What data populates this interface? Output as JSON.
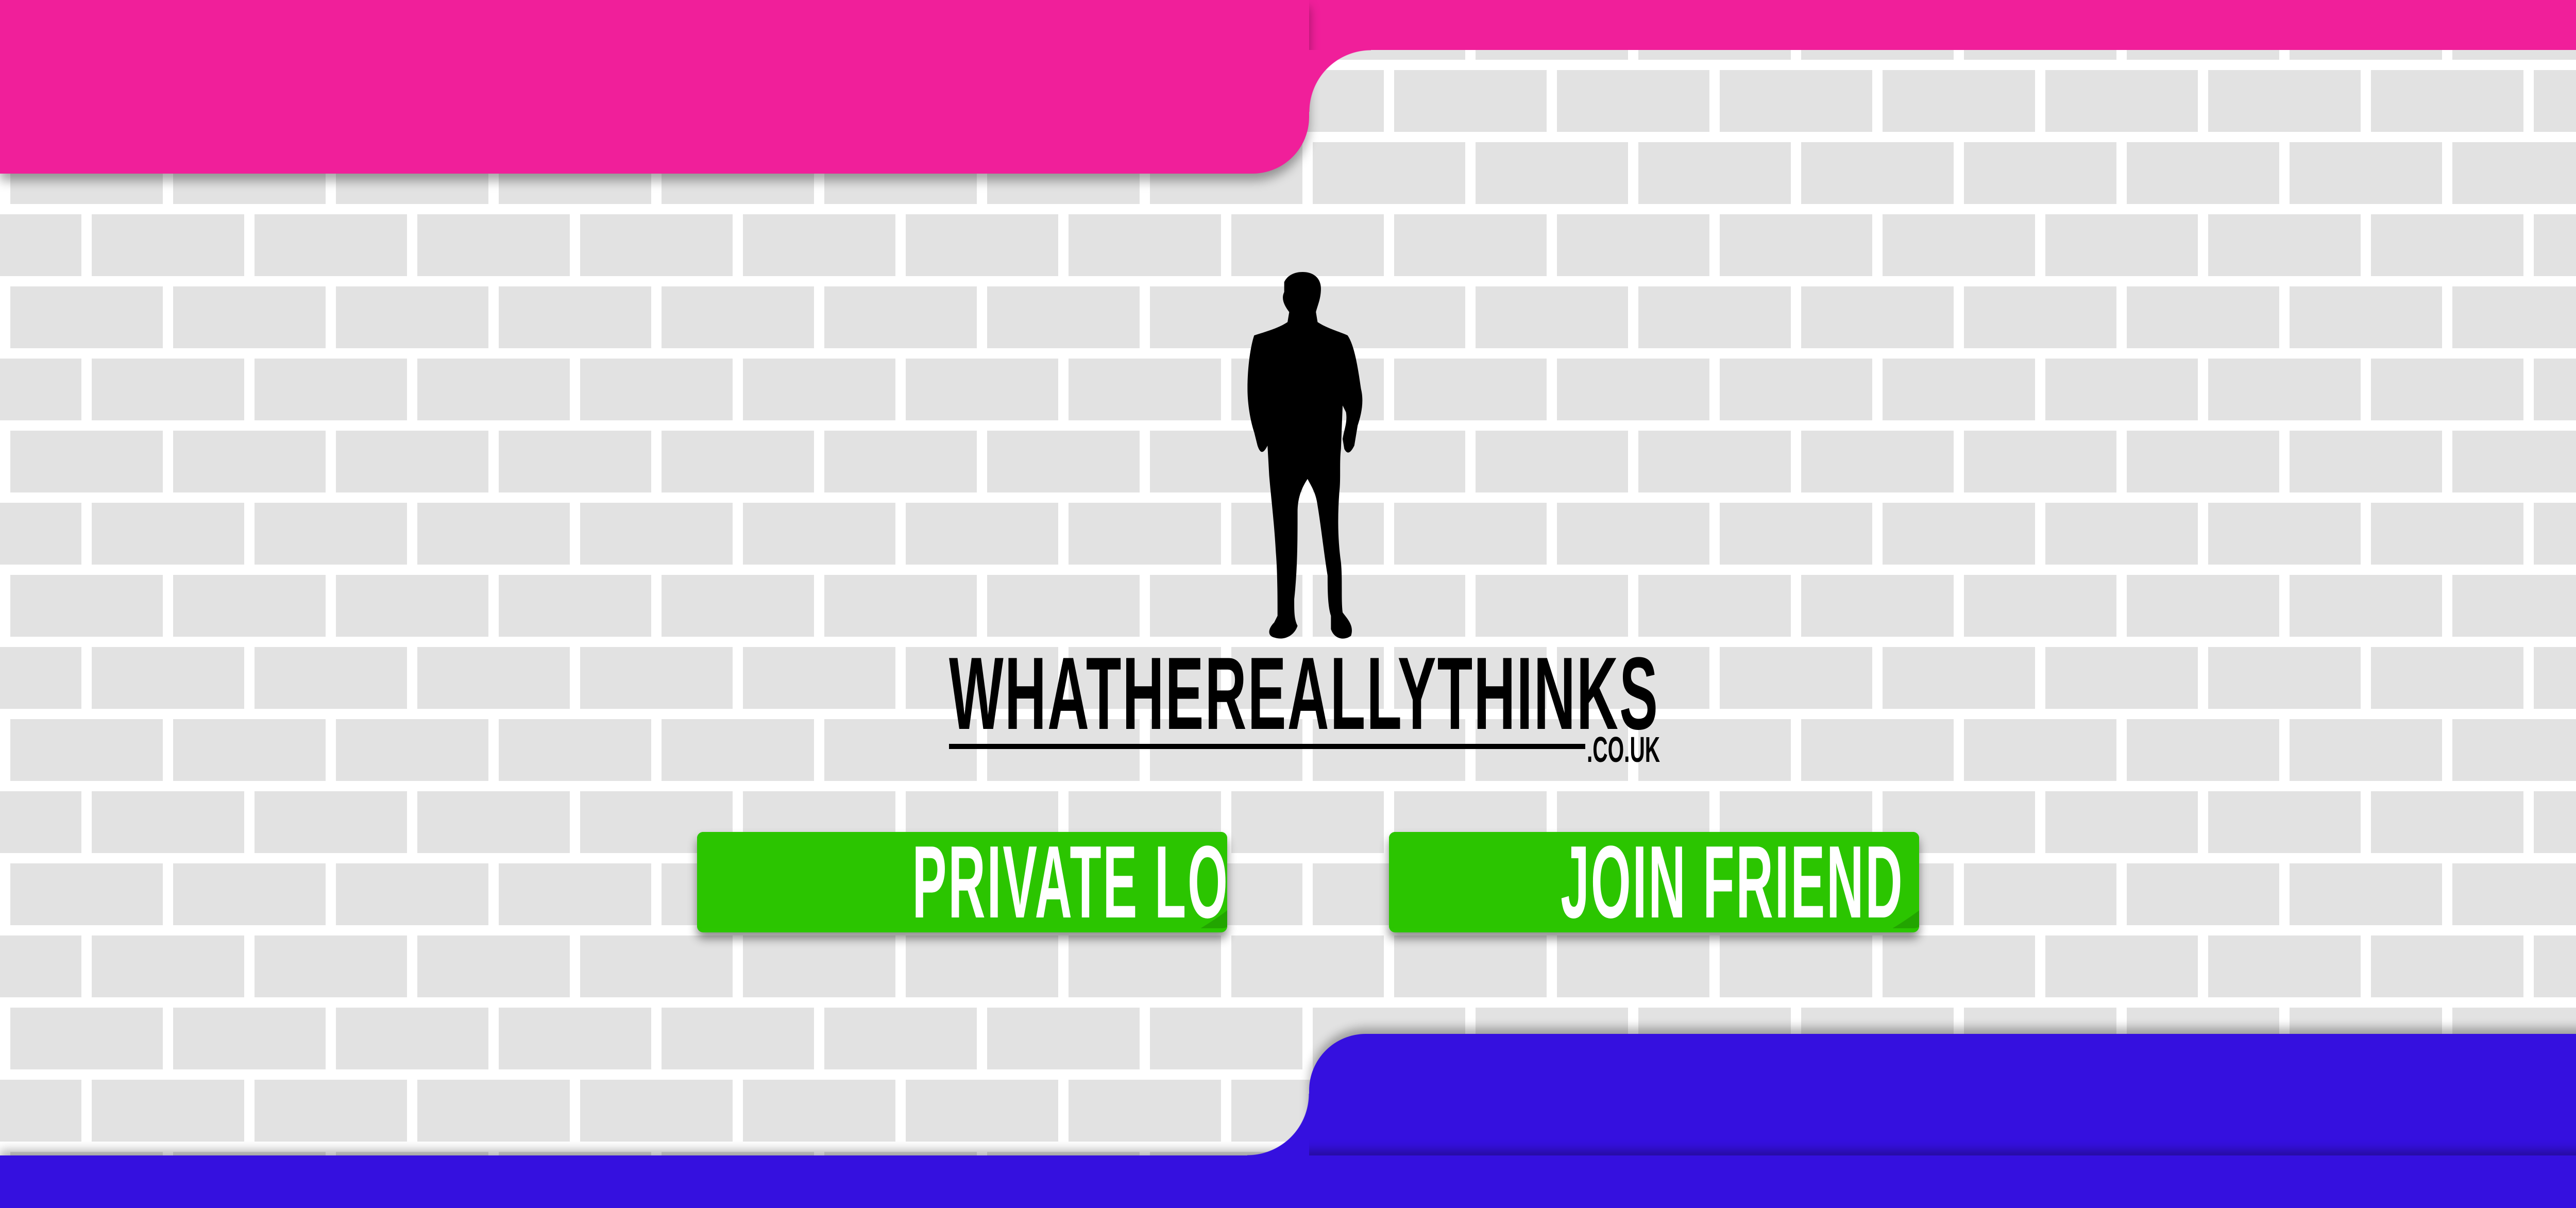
{
  "brand": {
    "name": "WHATHEREALLYTHINKS",
    "tld": ".CO.UK"
  },
  "buttons": {
    "private_lobby": "PRIVATE LOBBY",
    "join_friend": "JOIN FRIEND"
  },
  "colors": {
    "top_bar": "#f01f9a",
    "bottom_bar": "#3510df",
    "button": "#22a500",
    "brick": "#e2e2e2"
  }
}
